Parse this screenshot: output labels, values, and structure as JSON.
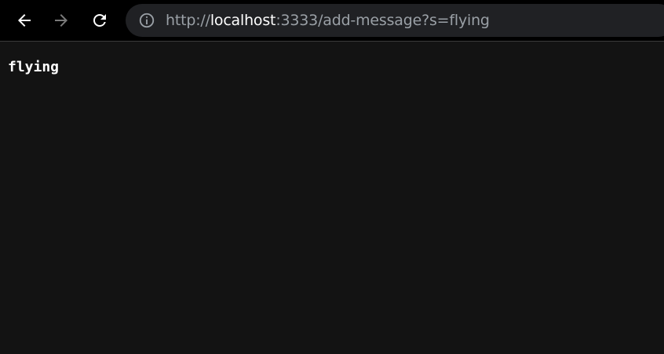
{
  "browser": {
    "address_bar": {
      "scheme": "http://",
      "host": "localhost",
      "rest": ":3333/add-message?s=flying"
    },
    "icons": {
      "back": "back-arrow-icon",
      "forward": "forward-arrow-icon",
      "reload": "reload-icon",
      "site_info": "info-icon"
    },
    "colors": {
      "toolbar_bg": "#000000",
      "omnibox_bg": "#202124",
      "page_bg": "#131313",
      "url_dim": "#9aa0a6",
      "url_host": "#ffffff",
      "forward_disabled": "#7a7a7a"
    }
  },
  "page": {
    "message": "flying"
  }
}
